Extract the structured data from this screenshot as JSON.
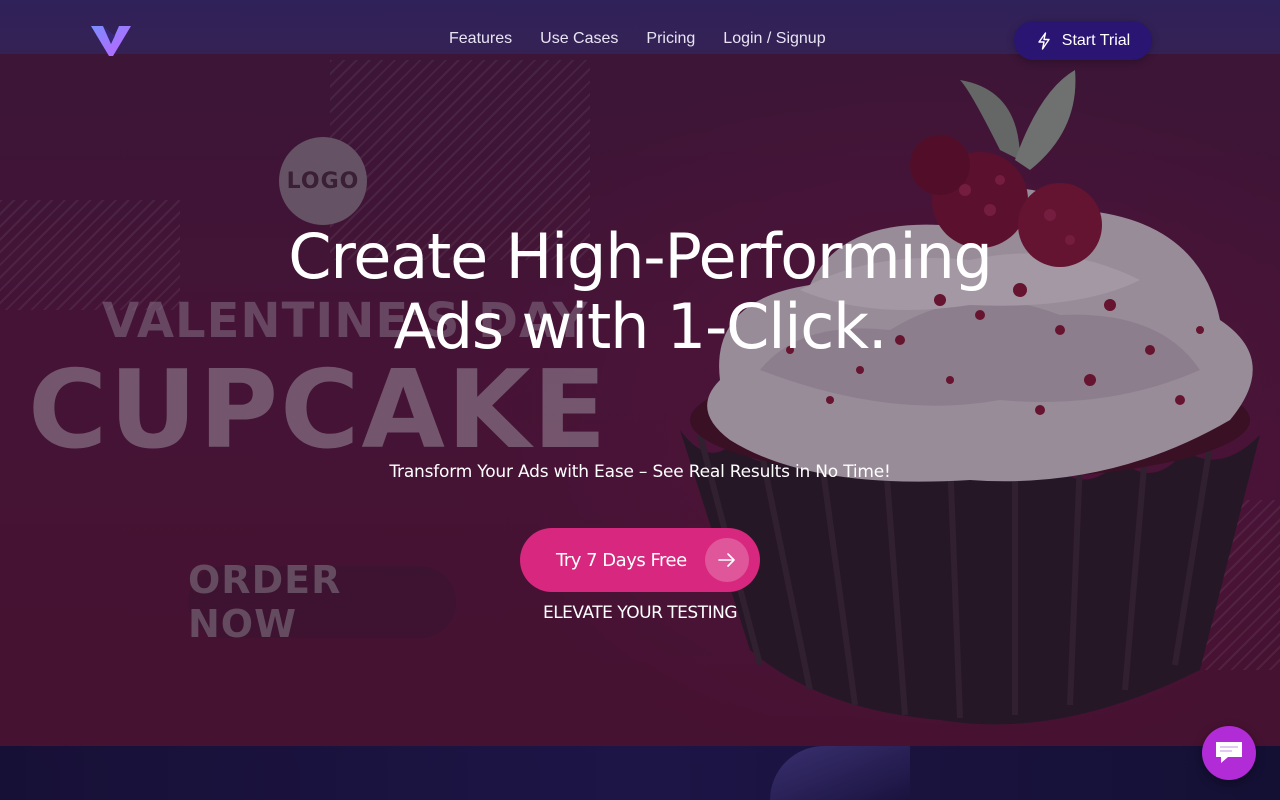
{
  "nav": {
    "logo_icon": "v-logo-icon",
    "links": [
      {
        "label": "Features"
      },
      {
        "label": "Use Cases"
      },
      {
        "label": "Pricing"
      },
      {
        "label": "Login / Signup"
      }
    ],
    "start_trial": {
      "label": "Start Trial",
      "icon": "lightning-bolt-icon"
    }
  },
  "hero": {
    "headline_line1": "Create High-Performing",
    "headline_line2": "Ads with 1-Click.",
    "subheadline": "Transform Your Ads with Ease – See Real Results in No Time!",
    "cta": {
      "label": "Try 7 Days Free",
      "icon": "arrow-right-icon"
    },
    "tagline": "ELEVATE YOUR TESTING"
  },
  "background_ad": {
    "logo_text": "LOGO",
    "title_small": "VALENTINE'S DAY",
    "title_big": "CUPCAKE",
    "button_text": "ORDER NOW"
  },
  "chat": {
    "icon": "chat-bubble-icon"
  },
  "colors": {
    "nav_bg": "#2e225c",
    "start_trial_bg": "#2a1572",
    "cta_bg": "#d8277f",
    "chat_bg": "#b12bd6",
    "hero_bg": "#5a1a3e",
    "bottom_band": "#1d1546"
  }
}
